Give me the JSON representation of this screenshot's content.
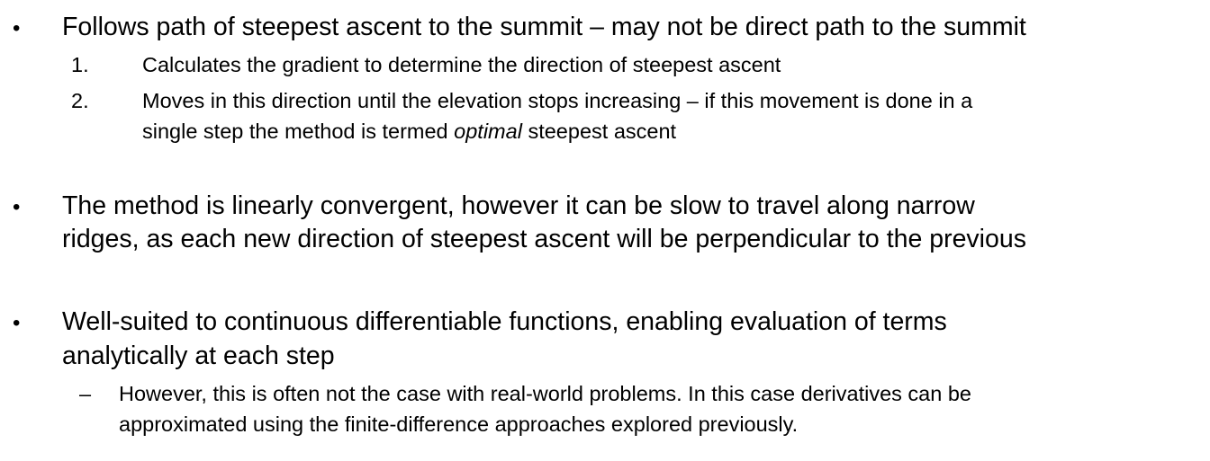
{
  "bullets": [
    {
      "marker": "•",
      "lines": [
        "Follows path of steepest ascent to the summit – may not be direct path to the summit"
      ],
      "numbered": [
        {
          "marker": "1.",
          "lines": [
            "Calculates the gradient to determine the direction of steepest ascent"
          ]
        },
        {
          "marker": "2.",
          "line1": "Moves in this direction until the elevation stops increasing – if this movement is done in a",
          "line2_before": "single step the method is termed ",
          "line2_italic": "optimal",
          "line2_after": " steepest ascent"
        }
      ]
    },
    {
      "marker": "•",
      "lines": [
        "The method is linearly convergent, however it can be slow to travel along narrow",
        "ridges, as each new direction of steepest ascent will be perpendicular to the previous"
      ]
    },
    {
      "marker": "•",
      "lines": [
        "Well-suited to continuous differentiable functions, enabling evaluation of terms",
        "analytically at each step"
      ],
      "dashes": [
        {
          "marker": "–",
          "lines": [
            "However, this is often not the case with real-world problems. In this case derivatives can be",
            "approximated using the finite-difference approaches explored previously."
          ]
        }
      ]
    }
  ]
}
